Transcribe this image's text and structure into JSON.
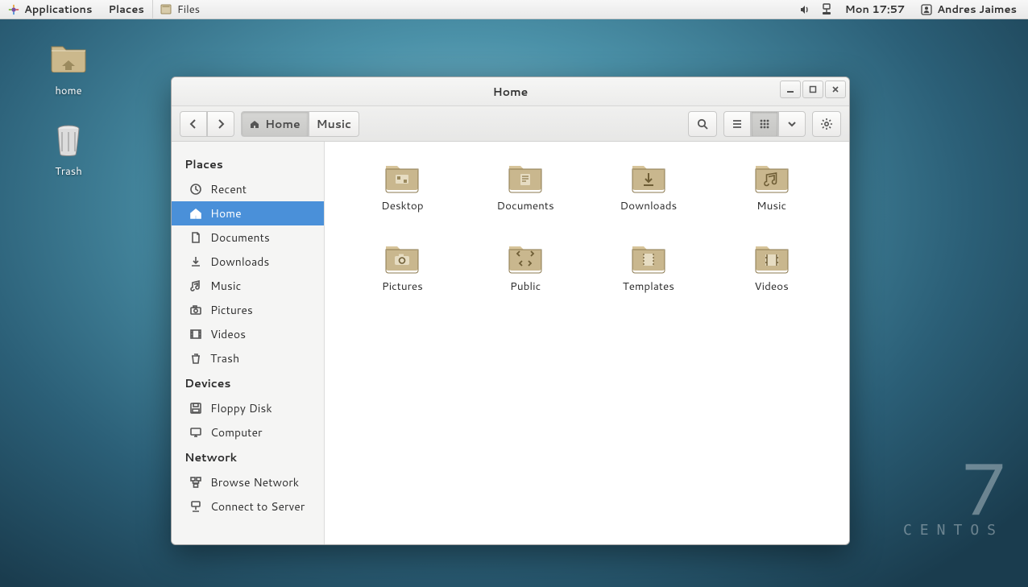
{
  "panel": {
    "applications": "Applications",
    "places": "Places",
    "task_app": "Files",
    "clock": "Mon 17:57",
    "user": "Andres Jaimes"
  },
  "desktop": {
    "home": "home",
    "trash": "Trash"
  },
  "brand": {
    "seven": "7",
    "name": "CENTOS"
  },
  "window": {
    "title": "Home",
    "crumb_home": "Home",
    "crumb_music": "Music"
  },
  "sidebar": {
    "places_head": "Places",
    "devices_head": "Devices",
    "network_head": "Network",
    "recent": "Recent",
    "home": "Home",
    "documents": "Documents",
    "downloads": "Downloads",
    "music": "Music",
    "pictures": "Pictures",
    "videos": "Videos",
    "trash": "Trash",
    "floppy": "Floppy Disk",
    "computer": "Computer",
    "browse": "Browse Network",
    "connect": "Connect to Server"
  },
  "folders": {
    "desktop": "Desktop",
    "documents": "Documents",
    "downloads": "Downloads",
    "music": "Music",
    "pictures": "Pictures",
    "public": "Public",
    "templates": "Templates",
    "videos": "Videos"
  }
}
